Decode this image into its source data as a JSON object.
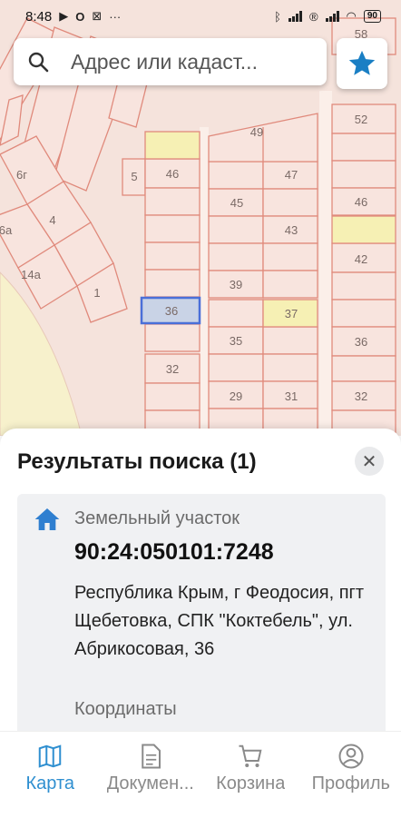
{
  "status_bar": {
    "time": "8:48",
    "battery": "90"
  },
  "map": {
    "parcel_labels": [
      "58",
      "52",
      "49",
      "46",
      "47",
      "46",
      "5",
      "45",
      "6г",
      "4",
      "43",
      "6а",
      "42",
      "14а",
      "1",
      "39",
      "36",
      "37",
      "35",
      "36",
      "32",
      "29",
      "31",
      "32"
    ],
    "selected_parcel": "36",
    "colors": {
      "background": "#f5e3dc",
      "grass": "#f7f1cc",
      "parcel_border": "#e08a7c",
      "parcel_fill": "#f8e4de",
      "highlight_yellow": "#f6f0b4",
      "selected_border": "#4a6fd8"
    }
  },
  "search": {
    "placeholder": "Адрес или кадаст..."
  },
  "results": {
    "title": "Результаты поиска (1)",
    "item": {
      "type": "Земельный участок",
      "number": "90:24:050101:7248",
      "address": "Республика Крым, г Феодосия, пгт Щебетовка, СПК \"Коктебель\", ул. Абрикосовая, 36",
      "coords_label": "Координаты"
    }
  },
  "nav": {
    "items": [
      {
        "label": "Карта",
        "icon": "map-icon",
        "active": true
      },
      {
        "label": "Докумен...",
        "icon": "document-icon",
        "active": false
      },
      {
        "label": "Корзина",
        "icon": "cart-icon",
        "active": false
      },
      {
        "label": "Профиль",
        "icon": "profile-icon",
        "active": false
      }
    ],
    "active_color": "#2f8fd0"
  },
  "accent_color": "#2f8fd0"
}
